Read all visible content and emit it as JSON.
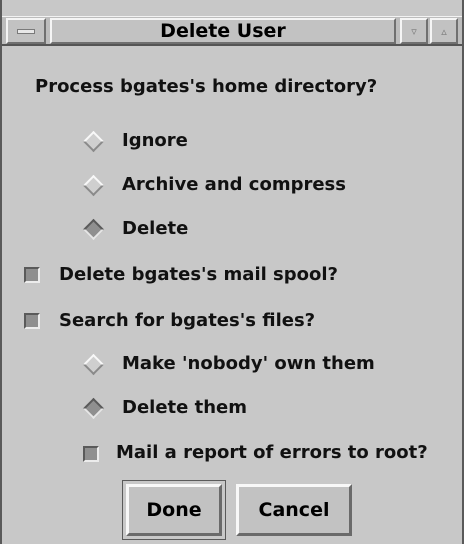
{
  "window": {
    "title": "Delete User",
    "minimize_glyph": "▿",
    "maximize_glyph": "▵"
  },
  "home_dir": {
    "question": "Process bgates's home directory?",
    "options": [
      {
        "label": "Ignore",
        "selected": false
      },
      {
        "label": "Archive and compress",
        "selected": false
      },
      {
        "label": "Delete",
        "selected": true
      }
    ]
  },
  "mail_spool": {
    "label": "Delete bgates's mail spool?",
    "checked": true
  },
  "search_files": {
    "label": "Search for bgates's files?",
    "checked": true,
    "options": [
      {
        "label": "Make 'nobody' own them",
        "selected": false
      },
      {
        "label": "Delete them",
        "selected": true
      }
    ],
    "report": {
      "label": "Mail a report of errors to root?",
      "checked": true
    }
  },
  "buttons": {
    "done": "Done",
    "cancel": "Cancel"
  }
}
